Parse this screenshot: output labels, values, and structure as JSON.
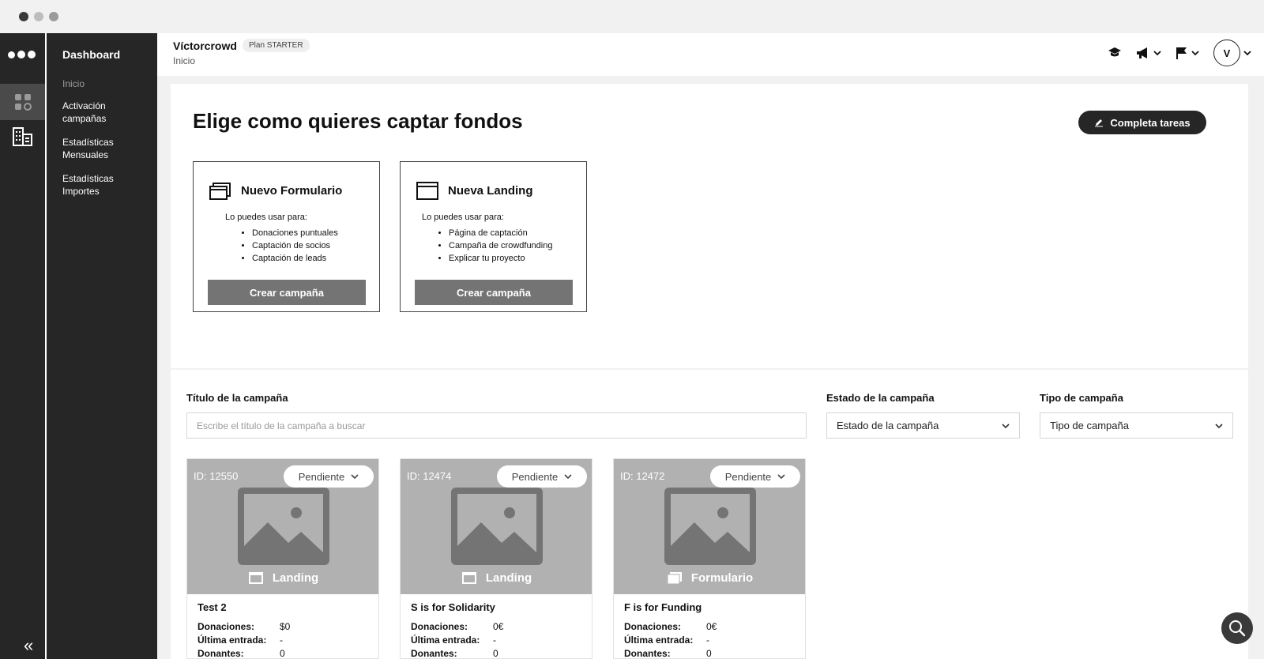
{
  "app": {
    "org_name": "Víctorcrowd",
    "plan_badge": "Plan STARTER",
    "breadcrumb": "Inicio"
  },
  "nav": {
    "title": "Dashboard",
    "items": [
      {
        "label": "Inicio",
        "active": true
      },
      {
        "label": "Activación campañas"
      },
      {
        "label": "Estadísticas Mensuales"
      },
      {
        "label": "Estadísticas Importes"
      }
    ]
  },
  "header_icons": [
    "graduation-cap-icon",
    "megaphone-icon",
    "flag-icon",
    "avatar"
  ],
  "avatar_initial": "V",
  "main": {
    "title": "Elige como quieres captar fondos",
    "tasks_button": "Completa tareas",
    "type_cards": [
      {
        "title": "Nuevo Formulario",
        "intro": "Lo puedes usar para:",
        "uses": [
          "Donaciones puntuales",
          "Captación de socios",
          "Captación de leads"
        ],
        "button": "Crear campaña"
      },
      {
        "title": "Nueva Landing",
        "intro": "Lo puedes usar para:",
        "uses": [
          "Página de captación",
          "Campaña de crowdfunding",
          "Explicar tu proyecto"
        ],
        "button": "Crear campaña"
      }
    ]
  },
  "filters": {
    "title_label": "Título de la campaña",
    "title_placeholder": "Escribe el título de la campaña a buscar",
    "status_label": "Estado de la campaña",
    "status_value": "Estado de la campaña",
    "type_label": "Tipo de campaña",
    "type_value": "Tipo de campaña"
  },
  "campaigns": [
    {
      "id": "ID: 12550",
      "status": "Pendiente",
      "type": "Landing",
      "name": "Test 2",
      "donaciones_label": "Donaciones:",
      "donaciones": "$0",
      "ultima_label": "Última entrada:",
      "ultima": "-",
      "donantes_label": "Donantes:",
      "donantes": "0"
    },
    {
      "id": "ID: 12474",
      "status": "Pendiente",
      "type": "Landing",
      "name": "S is for Solidarity",
      "donaciones_label": "Donaciones:",
      "donaciones": "0€",
      "ultima_label": "Última entrada:",
      "ultima": "-",
      "donantes_label": "Donantes:",
      "donantes": "0"
    },
    {
      "id": "ID: 12472",
      "status": "Pendiente",
      "type": "Formulario",
      "name": "F is for Funding",
      "donaciones_label": "Donaciones:",
      "donaciones": "0€",
      "ultima_label": "Última entrada:",
      "ultima": "-",
      "donantes_label": "Donantes:",
      "donantes": "0"
    }
  ],
  "colors": {
    "sidebar": "#262626",
    "rail_active": "#4a4a4a",
    "button_gray": "#747474",
    "image_placeholder": "#b1b1b1",
    "content_bg": "#f1f1f1"
  }
}
